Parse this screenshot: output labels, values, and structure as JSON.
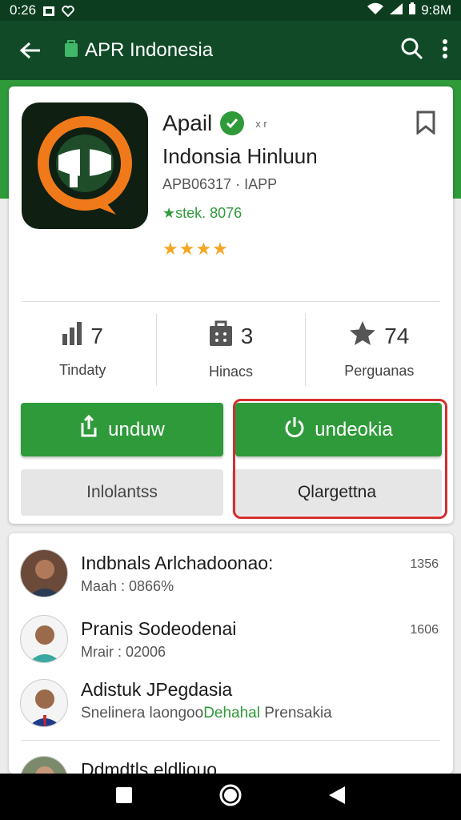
{
  "status_bar": {
    "time": "0:26",
    "right_text": "9:8M"
  },
  "app_bar": {
    "title": "APR Indonesia"
  },
  "app": {
    "name": "Apail",
    "tag": "x r",
    "subtitle": "Indonsia Hinluun",
    "developer": "APB06317 · IAPP",
    "stat_line": "★stek. 8076",
    "stars": "★★★★"
  },
  "stats": [
    {
      "icon": "bar-chart-icon",
      "value": "7",
      "label": "Tindaty"
    },
    {
      "icon": "shopping-bag-icon",
      "value": "3",
      "label": "Hinacs"
    },
    {
      "icon": "star-icon",
      "value": "74",
      "label": "Perguanas"
    }
  ],
  "buttons": {
    "download_label": "unduw",
    "update_label": "undeokia",
    "secondary_left": "Inlolantss",
    "secondary_right": "Qlargettna"
  },
  "list": [
    {
      "name": "Indbnals Arlchadoonao:",
      "sub": "Maah : 0866%",
      "count": "1356"
    },
    {
      "name": "Pranis Sodeodenai",
      "sub": "Mrair : 02006",
      "count": "1606"
    },
    {
      "name": "Adistuk JPegdasia",
      "sub_a": "Snelinera laongoo",
      "sub_green": "Dehahal",
      "sub_b": " Prensakia",
      "count": ""
    },
    {
      "name": "Ddmdtls eldliouo",
      "sub": "",
      "count": ""
    }
  ],
  "colors": {
    "primary_dark": "#114a27",
    "accent_green": "#2f9a3a",
    "highlight_red": "#d32f2f",
    "star": "#f5a623"
  }
}
